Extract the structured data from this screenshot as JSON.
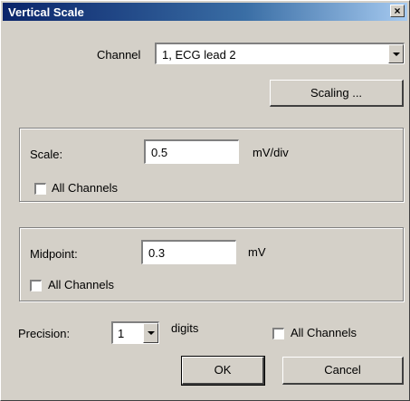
{
  "window": {
    "title": "Vertical Scale",
    "close_glyph": "×"
  },
  "channel": {
    "label": "Channel",
    "value": "1, ECG lead 2"
  },
  "scaling_button": "Scaling ...",
  "scale_group": {
    "label": "Scale:",
    "value": "0.5",
    "unit": "mV/div",
    "all_channels": {
      "label": "All Channels",
      "checked": false
    }
  },
  "midpoint_group": {
    "label": "Midpoint:",
    "value": "0.3",
    "unit": "mV",
    "all_channels": {
      "label": "All Channels",
      "checked": false
    }
  },
  "precision": {
    "label": "Precision:",
    "value": "1",
    "unit": "digits",
    "all_channels": {
      "label": "All Channels",
      "checked": false
    }
  },
  "buttons": {
    "ok": "OK",
    "cancel": "Cancel"
  },
  "colors": {
    "dialog_bg": "#d4d0c8",
    "titlebar_start": "#0a246a",
    "titlebar_end": "#a6caf0"
  }
}
